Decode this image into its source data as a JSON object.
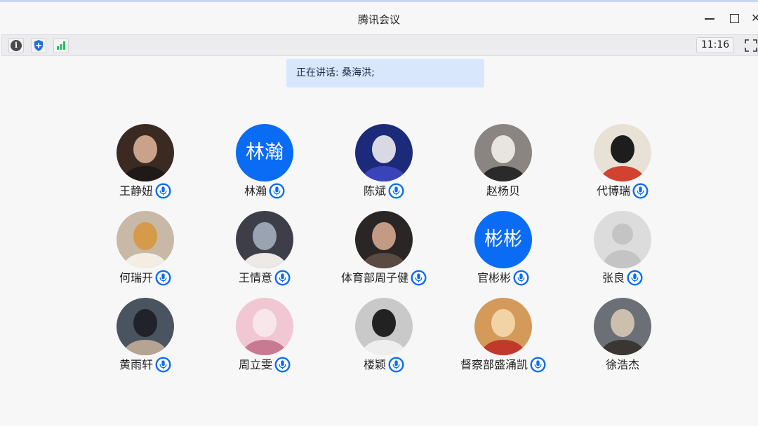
{
  "window": {
    "title": "腾讯会议"
  },
  "toolbar": {
    "info_icon": "info-icon",
    "shield_icon": "shield-icon",
    "signal_icon": "signal-bars-icon",
    "clock": "11:16",
    "fullscreen_icon": "fullscreen-icon"
  },
  "speaking": {
    "text": "正在讲话: 桑海洪;"
  },
  "colors": {
    "accent": "#0a6cf5",
    "speaking_bg": "#d9e7fc",
    "signal": "#1fc35c"
  },
  "participants": [
    {
      "name": "王静妞",
      "avatar": "photo",
      "mic": true
    },
    {
      "name": "林瀚",
      "avatar": "text",
      "avatar_text": "林瀚",
      "mic": true
    },
    {
      "name": "陈斌",
      "avatar": "photo",
      "mic": true
    },
    {
      "name": "赵杨贝",
      "avatar": "photo",
      "mic": false
    },
    {
      "name": "代博瑞",
      "avatar": "photo",
      "mic": true
    },
    {
      "name": "何瑞开",
      "avatar": "photo",
      "mic": true
    },
    {
      "name": "王情意",
      "avatar": "photo",
      "mic": true
    },
    {
      "name": "体育部周子健",
      "avatar": "photo",
      "mic": true
    },
    {
      "name": "官彬彬",
      "avatar": "text",
      "avatar_text": "彬彬",
      "mic": true
    },
    {
      "name": "张良",
      "avatar": "default",
      "mic": true
    },
    {
      "name": "黄雨轩",
      "avatar": "photo",
      "mic": true
    },
    {
      "name": "周立雯",
      "avatar": "photo",
      "mic": true
    },
    {
      "name": "楼颖",
      "avatar": "photo",
      "mic": true
    },
    {
      "name": "督察部盛涌凯",
      "avatar": "photo",
      "mic": true
    },
    {
      "name": "徐浩杰",
      "avatar": "photo",
      "mic": false
    }
  ]
}
